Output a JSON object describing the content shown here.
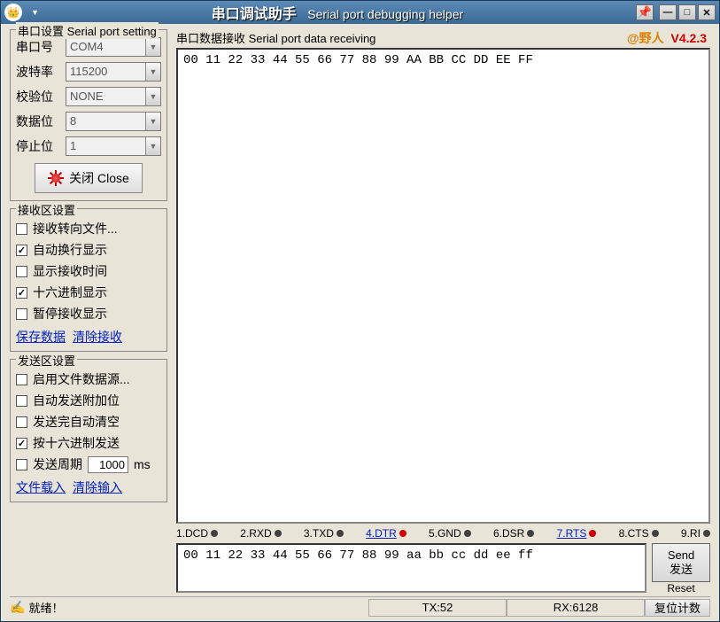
{
  "titlebar": {
    "title_cn": "串口调试助手",
    "title_en": "Serial port debugging helper"
  },
  "brand": {
    "name": "@野人",
    "version": "V4.2.3"
  },
  "port_settings": {
    "legend": "串口设置 Serial port setting",
    "port_label": "串口号",
    "port_value": "COM4",
    "baud_label": "波特率",
    "baud_value": "115200",
    "parity_label": "校验位",
    "parity_value": "NONE",
    "databits_label": "数据位",
    "databits_value": "8",
    "stopbits_label": "停止位",
    "stopbits_value": "1",
    "close_label": "关闭 Close"
  },
  "recv_settings": {
    "legend": "接收区设置",
    "to_file": "接收转向文件...",
    "auto_wrap": "自动换行显示",
    "show_time": "显示接收时间",
    "hex_display": "十六进制显示",
    "pause": "暂停接收显示",
    "save_link": "保存数据",
    "clear_link": "清除接收"
  },
  "send_settings": {
    "legend": "发送区设置",
    "file_src": "启用文件数据源...",
    "auto_extra": "自动发送附加位",
    "clear_after": "发送完自动清空",
    "hex_send": "按十六进制发送",
    "period_label": "发送周期",
    "period_value": "1000",
    "period_unit": "ms",
    "load_file": "文件载入",
    "clear_input": "清除输入"
  },
  "recv_area": {
    "legend": "串口数据接收   Serial port data receiving",
    "content": "00 11 22 33 44 55 66 77 88 99 AA BB CC DD EE FF"
  },
  "signals": {
    "s1": "1.DCD",
    "s2": "2.RXD",
    "s3": "3.TXD",
    "s4": "4.DTR",
    "s5": "5.GND",
    "s6": "6.DSR",
    "s7": "7.RTS",
    "s8": "8.CTS",
    "s9": "9.RI"
  },
  "send_area": {
    "content": "00 11 22 33 44 55 66 77 88 99 aa bb cc dd ee ff",
    "send_en": "Send",
    "send_cn": "发送",
    "reset_label": "Reset"
  },
  "status": {
    "ready": "就绪！",
    "tx": "TX:52",
    "rx": "RX:6128",
    "reset_counter": "复位计数"
  }
}
